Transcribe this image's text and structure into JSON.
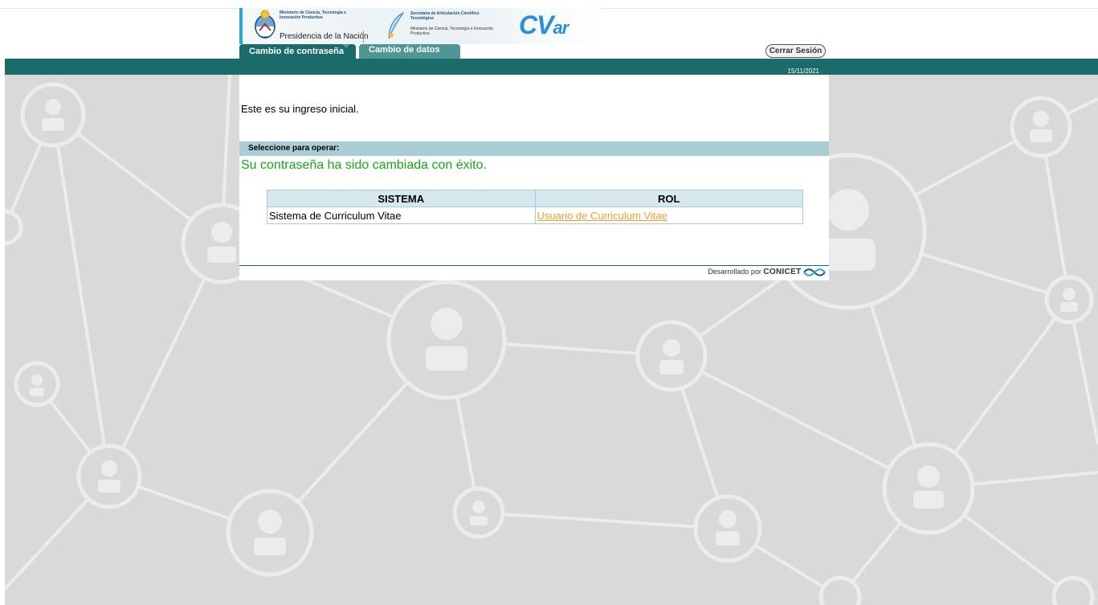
{
  "header": {
    "ministry_text": "Ministerio de Ciencia, Tecnología e Innovación Productiva",
    "presidency_text": "Presidencia de la Nación",
    "secretary_text": "Secretaría de Articulación Científico Tecnológica",
    "secretary_sub": "Ministerio de Ciencia, Tecnología e Innovación Productiva",
    "app_logo_main": "CV",
    "app_logo_suffix": "ar",
    "logout_label": "Cerrar Sesión",
    "date": "15/11/2021"
  },
  "tabs": [
    {
      "label": "Cambio de contraseña",
      "active": true
    },
    {
      "label": "Cambio de datos",
      "active": false
    }
  ],
  "main": {
    "welcome_text": "Este es su ingreso inicial.",
    "section_title": "Seleccione para operar:",
    "success_message": "Su contraseña ha sido cambiada con éxito.",
    "table": {
      "headers": [
        "SISTEMA",
        "ROL"
      ],
      "rows": [
        {
          "sistema": "Sistema de Curriculum Vitae",
          "rol": "Usuario de Curriculum Vitae"
        }
      ]
    }
  },
  "footer": {
    "developed_by": "Desarrollado por",
    "brand": "CONICET"
  },
  "colors": {
    "teal_bar": "#1c6b6b",
    "section_bar": "#a9cdd4",
    "success": "#1aa51a",
    "link": "#f0a030"
  }
}
